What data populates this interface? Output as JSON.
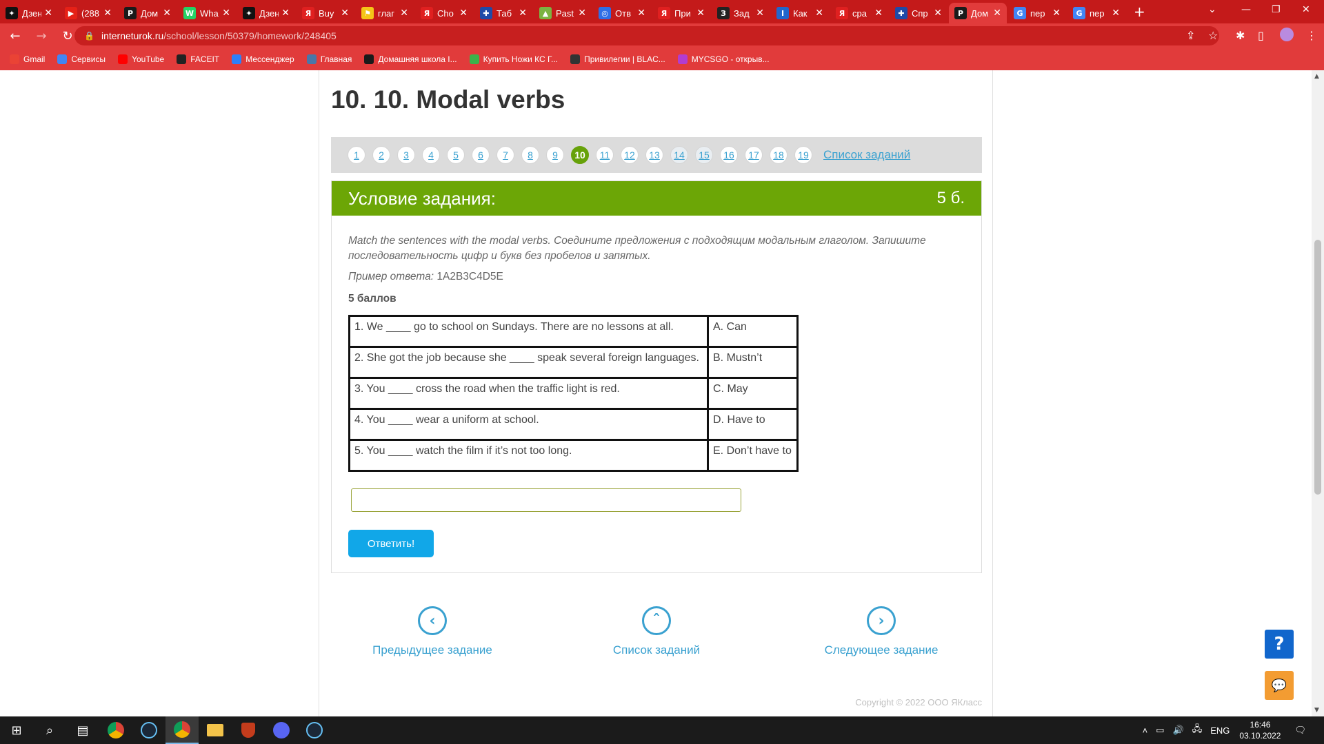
{
  "browser": {
    "tabs": [
      {
        "label": "Дзен",
        "color": "#111111",
        "glyph": "✦"
      },
      {
        "label": "(288",
        "color": "#e62117",
        "glyph": "▶"
      },
      {
        "label": "Дом",
        "color": "#1a1a1a",
        "glyph": "P"
      },
      {
        "label": "Wha",
        "color": "#25d366",
        "glyph": "W"
      },
      {
        "label": "Дзен",
        "color": "#111111",
        "glyph": "✦"
      },
      {
        "label": "Buy",
        "color": "#e02020",
        "glyph": "Я"
      },
      {
        "label": "глаг",
        "color": "#f5c518",
        "glyph": "⚑"
      },
      {
        "label": "Cho",
        "color": "#e02020",
        "glyph": "Я"
      },
      {
        "label": "Таб",
        "color": "#1f4aa8",
        "glyph": "✚"
      },
      {
        "label": "Past",
        "color": "#7cb342",
        "glyph": "▲"
      },
      {
        "label": "Отв",
        "color": "#2f6ee6",
        "glyph": "◎"
      },
      {
        "label": "При",
        "color": "#e02020",
        "glyph": "Я"
      },
      {
        "label": "Зад",
        "color": "#222222",
        "glyph": "З"
      },
      {
        "label": "Как",
        "color": "#2266cc",
        "glyph": "I"
      },
      {
        "label": "сра",
        "color": "#e02020",
        "glyph": "Я"
      },
      {
        "label": "Спр",
        "color": "#1f4aa8",
        "glyph": "✚"
      },
      {
        "label": "Дом",
        "color": "#1a1a1a",
        "glyph": "P"
      },
      {
        "label": "пер",
        "color": "#4285f4",
        "glyph": "G"
      },
      {
        "label": "пер",
        "color": "#4285f4",
        "glyph": "G"
      }
    ],
    "active_tab_index": 16,
    "url_host": "interneturok.ru",
    "url_path": "/school/lesson/50379/homework/248405",
    "bookmarks": [
      {
        "label": "Gmail",
        "color": "#ea4335"
      },
      {
        "label": "Сервисы",
        "color": "#4285f4"
      },
      {
        "label": "YouTube",
        "color": "#ff0000"
      },
      {
        "label": "FACEIT",
        "color": "#222222"
      },
      {
        "label": "Мессенджер",
        "color": "#2d7ff9"
      },
      {
        "label": "Главная",
        "color": "#4a76a8"
      },
      {
        "label": "Домашняя школа I...",
        "color": "#1a1a1a"
      },
      {
        "label": "Купить Ножи КС Г...",
        "color": "#3bb34a"
      },
      {
        "label": "Привилегии | BLAC...",
        "color": "#333333"
      },
      {
        "label": "MYCSGO - открыв...",
        "color": "#b23cd0"
      }
    ]
  },
  "lesson": {
    "title": "10. 10. Modal verbs",
    "task_numbers": [
      "1",
      "2",
      "3",
      "4",
      "5",
      "6",
      "7",
      "8",
      "9",
      "10",
      "11",
      "12",
      "13",
      "14",
      "15",
      "16",
      "17",
      "18",
      "19"
    ],
    "current_task": "10",
    "done_tasks": [
      "14",
      "15"
    ],
    "task_list_link": "Список заданий"
  },
  "task": {
    "header_title": "Условие задания:",
    "header_points": "5 б.",
    "instructions": "Match the sentences with the modal verbs. Соедините предложения с подходящим модальным глаголом. Запишите последовательность цифр и букв без пробелов и запятых.",
    "example_label": "Пример ответа:",
    "example_value": "1A2B3C4D5E",
    "points_label": "5 баллов",
    "rows": [
      {
        "sentence": "1. We ____ go to school on Sundays. There are no lessons at all.",
        "verb": "A. Can"
      },
      {
        "sentence": "2. She got the job because she ____ speak several foreign languages.",
        "verb": "B. Mustn’t"
      },
      {
        "sentence": "3. You ____ cross the road when the traffic light is red.",
        "verb": "C. May"
      },
      {
        "sentence": "4. You ____ wear a uniform at school.",
        "verb": "D. Have to"
      },
      {
        "sentence": "5. You ____ watch the film if it’s not too long.",
        "verb": "E. Don’t have to"
      }
    ],
    "answer_value": "",
    "submit_label": "Ответить!"
  },
  "bottom_nav": {
    "prev_label": "Предыдущее задание",
    "list_label": "Список заданий",
    "next_label": "Следующее задание"
  },
  "copyright": "Copyright © 2022 ООО ЯКласс",
  "taskbar": {
    "lang": "ENG",
    "time": "16:46",
    "date": "03.10.2022"
  },
  "colors": {
    "chrome_red": "#e13b3b",
    "task_green": "#6ca606",
    "link_blue": "#3aa1d0",
    "submit_blue": "#11a7e8"
  }
}
